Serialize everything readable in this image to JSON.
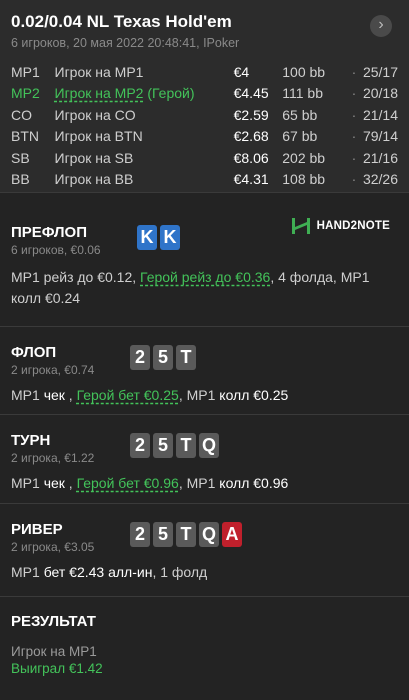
{
  "header": {
    "title": "0.02/0.04 NL Texas Hold'em",
    "subtitle": "6 игроков, 20 мая 2022 20:48:41, IPoker",
    "next_icon": "chevron-right-icon"
  },
  "players": [
    {
      "pos": "MP1",
      "name": "Игрок на MP1",
      "hero_label": "",
      "stack": "€4",
      "bb": "100 bb",
      "sep": "·",
      "stat": "25/17",
      "hero": false
    },
    {
      "pos": "MP2",
      "name": "Игрок на MP2",
      "hero_label": " (Герой)",
      "stack": "€4.45",
      "bb": "111 bb",
      "sep": "·",
      "stat": "20/18",
      "hero": true
    },
    {
      "pos": "CO",
      "name": "Игрок на CO",
      "hero_label": "",
      "stack": "€2.59",
      "bb": "65 bb",
      "sep": "·",
      "stat": "21/14",
      "hero": false
    },
    {
      "pos": "BTN",
      "name": "Игрок на BTN",
      "hero_label": "",
      "stack": "€2.68",
      "bb": "67 bb",
      "sep": "·",
      "stat": "79/14",
      "hero": false
    },
    {
      "pos": "SB",
      "name": "Игрок на SB",
      "hero_label": "",
      "stack": "€8.06",
      "bb": "202 bb",
      "sep": "·",
      "stat": "21/16",
      "hero": false
    },
    {
      "pos": "BB",
      "name": "Игрок на BB",
      "hero_label": "",
      "stack": "€4.31",
      "bb": "108 bb",
      "sep": "·",
      "stat": "32/26",
      "hero": false
    }
  ],
  "preflop": {
    "title": "ПРЕФЛОП",
    "sub": "6 игроков, €0.06",
    "cards": [
      "K",
      "K"
    ],
    "logo_text": "HAND2NOTE",
    "a1": "MP1 рейз до €0.12, ",
    "a2": "Герой рейз до €0.36",
    "a3": ", 4 фолда, MP1",
    "a4": "колл €0.24"
  },
  "flop": {
    "title": "ФЛОП",
    "sub": "2 игрока, €0.74",
    "cards": [
      "2",
      "5",
      "T"
    ],
    "a1": "MP1 ",
    "a2": "чек",
    "a3": " , ",
    "a4": "Герой бет €0.25",
    "a5": ", MP1 ",
    "a6": "колл €0.25"
  },
  "turn": {
    "title": "ТУРН",
    "sub": "2 игрока, €1.22",
    "cards": [
      "2",
      "5",
      "T",
      "Q"
    ],
    "a1": "MP1 ",
    "a2": "чек",
    "a3": " , ",
    "a4": "Герой бет €0.96",
    "a5": ", MP1 ",
    "a6": "колл €0.96"
  },
  "river": {
    "title": "РИВЕР",
    "sub": "2 игрока, €3.05",
    "cards": [
      "2",
      "5",
      "T",
      "Q",
      "A"
    ],
    "a1": "MP1 ",
    "a2": "бет €2.43 алл-ин",
    "a3": ", 1 фолд"
  },
  "result": {
    "title": "РЕЗУЛЬТАТ",
    "name": "Игрок на MP1",
    "win": "Выиграл €1.42"
  },
  "colors": {
    "hero_green": "#43c35a",
    "card_blue": "#2f74c9",
    "card_red": "#c0202c",
    "card_gray": "#5a5a5a"
  }
}
